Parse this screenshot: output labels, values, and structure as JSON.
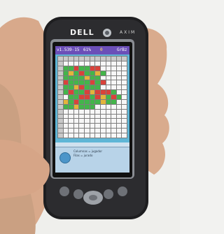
{
  "device": {
    "brand": "DELL",
    "model": "AXIM"
  },
  "screen": {
    "status_bar": {
      "version_text": "v1.539-15",
      "battery_text": "61%",
      "signal_text": "0",
      "app_text": "GrBz"
    },
    "grid_rows": [
      [
        "h",
        "h",
        "h",
        "h",
        "h",
        "h",
        "h",
        "h",
        "h",
        "h",
        "h",
        "h",
        "h"
      ],
      [
        "h",
        "w",
        "w",
        "w",
        "w",
        "w",
        "w",
        "w",
        "w",
        "w",
        "w",
        "w",
        "w"
      ],
      [
        "h",
        "g",
        "g",
        "r",
        "g",
        "g",
        "r",
        "r",
        "w",
        "w",
        "w",
        "w",
        "w"
      ],
      [
        "h",
        "g",
        "y",
        "g",
        "r",
        "g",
        "g",
        "y",
        "g",
        "w",
        "w",
        "w",
        "w"
      ],
      [
        "h",
        "g",
        "g",
        "g",
        "g",
        "y",
        "g",
        "g",
        "w",
        "w",
        "w",
        "w",
        "w"
      ],
      [
        "h",
        "r",
        "g",
        "g",
        "g",
        "g",
        "r",
        "g",
        "r",
        "w",
        "w",
        "w",
        "w"
      ],
      [
        "h",
        "g",
        "g",
        "y",
        "r",
        "g",
        "g",
        "g",
        "w",
        "w",
        "w",
        "w",
        "w"
      ],
      [
        "h",
        "g",
        "r",
        "g",
        "g",
        "r",
        "y",
        "r",
        "r",
        "r",
        "g",
        "w",
        "w"
      ],
      [
        "h",
        "w",
        "g",
        "g",
        "r",
        "r",
        "g",
        "r",
        "y",
        "g",
        "r",
        "g",
        "w"
      ],
      [
        "h",
        "y",
        "g",
        "r",
        "g",
        "g",
        "g",
        "g",
        "y",
        "g",
        "g",
        "w",
        "w"
      ],
      [
        "h",
        "g",
        "g",
        "y",
        "g",
        "g",
        "g",
        "w",
        "w",
        "w",
        "w",
        "w",
        "w"
      ],
      [
        "h",
        "w",
        "w",
        "w",
        "w",
        "w",
        "w",
        "w",
        "w",
        "w",
        "w",
        "w",
        "w"
      ],
      [
        "h",
        "w",
        "w",
        "w",
        "w",
        "w",
        "w",
        "w",
        "w",
        "w",
        "w",
        "w",
        "w"
      ],
      [
        "h",
        "w",
        "w",
        "w",
        "w",
        "w",
        "w",
        "w",
        "w",
        "w",
        "w",
        "w",
        "w"
      ],
      [
        "h",
        "w",
        "w",
        "w",
        "w",
        "w",
        "w",
        "w",
        "w",
        "w",
        "w",
        "w",
        "w"
      ],
      [
        "h",
        "w",
        "w",
        "w",
        "w",
        "w",
        "w",
        "w",
        "w",
        "w",
        "w",
        "w",
        "w"
      ],
      [
        "h",
        "w",
        "w",
        "w",
        "w",
        "w",
        "w",
        "w",
        "w",
        "w",
        "w",
        "w",
        "w"
      ]
    ],
    "bottom_text_line1": "Columnas = jugador",
    "bottom_text_line2": "Filas = jurado"
  },
  "colors": {
    "cell_green": "#43b54a",
    "cell_red": "#d9423a",
    "cell_yellow": "#e3b43a",
    "status_bar": "#6b4fb8"
  }
}
